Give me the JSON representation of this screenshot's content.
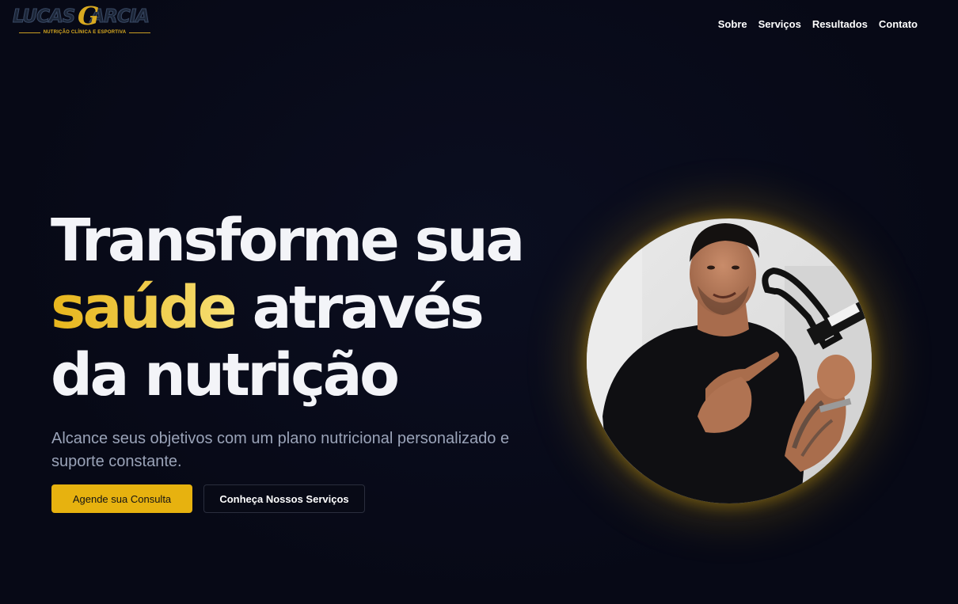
{
  "brand": {
    "logo_name_left": "LUCAS",
    "logo_initial": "G",
    "logo_name_right": "ARCIA",
    "logo_tagline": "NUTRIÇÃO CLÍNICA E ESPORTIVA",
    "accent_color": "#e7b20f"
  },
  "nav": {
    "items": [
      {
        "label": "Sobre"
      },
      {
        "label": "Serviços"
      },
      {
        "label": "Resultados"
      },
      {
        "label": "Contato"
      }
    ]
  },
  "hero": {
    "title_line1": "Transforme sua",
    "title_accent": "saúde",
    "title_line2_rest": " através",
    "title_line3": "da nutrição",
    "subtitle": "Alcance seus objetivos com um plano nutricional personalizado e suporte constante.",
    "primary_button": "Agende sua Consulta",
    "secondary_button": "Conheça Nossos Serviços"
  },
  "portrait": {
    "icon": "nutritionist-photo"
  }
}
